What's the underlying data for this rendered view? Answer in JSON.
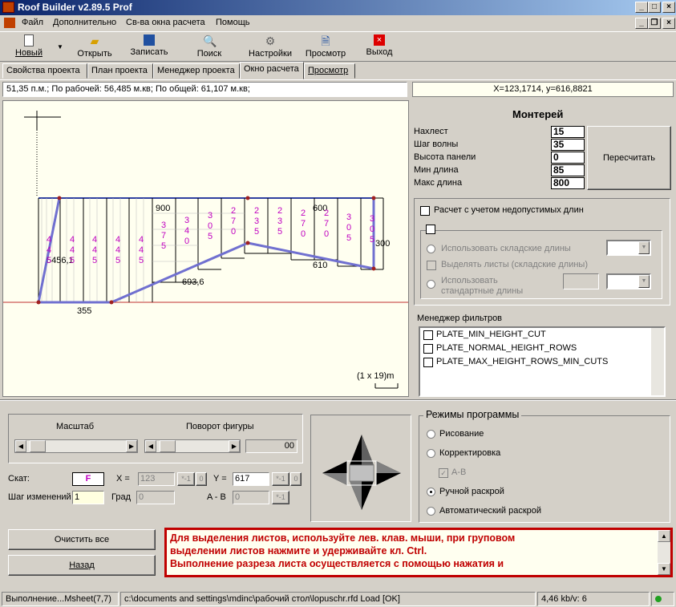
{
  "window": {
    "title": "Roof Builder v2.89.5 Prof"
  },
  "menu": [
    "Файл",
    "Дополнительно",
    "Св-ва окна расчета",
    "Помощь"
  ],
  "toolbar": {
    "new": "Новый",
    "open": "Открыть",
    "save": "Записать",
    "search": "Поиск",
    "settings": "Настройки",
    "preview": "Просмотр",
    "exit": "Выход"
  },
  "tabs": [
    "Свойства проекта",
    "План проекта",
    "Менеджер проекта",
    "Окно расчета",
    "Просмотр"
  ],
  "info": {
    "area": "51,35 п.м.; По рабочей: 56,485 м.кв; По общей:  61,107 м.кв;",
    "coords": "X=123,1714, y=616,8821"
  },
  "drawing": {
    "labels": [
      "900",
      "600",
      "610",
      "300",
      "693,6",
      "355",
      "5456,1"
    ],
    "sheet_lengths": [
      "4 4 5",
      "4 4 5",
      "4 4 5",
      "4 4 5",
      "4 4 5",
      "3 7 5",
      "3 4 0",
      "3 0 5",
      "2 7 0",
      "2 3 5",
      "2 3 5",
      "2 7 0",
      "2 7 0",
      "3 0 5",
      "3 0 5"
    ],
    "scale_label": "(1 x 19)m"
  },
  "profile": {
    "name": "Монтерей",
    "overlap_label": "Нахлест",
    "overlap": "15",
    "wave_label": "Шаг волны",
    "wave": "35",
    "height_label": "Высота панели",
    "height": "0",
    "minlen_label": "Мин длина",
    "minlen": "85",
    "maxlen_label": "Макс длина",
    "maxlen": "800",
    "recalc": "Пересчитать"
  },
  "options": {
    "invalid_lengths": "Расчет с учетом недопустимых длин",
    "use_stock": "Использовать складские длины",
    "highlight": "Выделять листы (складские длины)",
    "use_std_1": "Использовать",
    "use_std_2": "стандартные длины"
  },
  "filters": {
    "title": "Менеджер фильтров",
    "items": [
      "PLATE_MIN_HEIGHT_CUT",
      "PLATE_NORMAL_HEIGHT_ROWS",
      "PLATE_MAX_HEIGHT_ROWS_MIN_CUTS"
    ]
  },
  "controls": {
    "scale_label": "Масштаб",
    "rotate_label": "Поворот фигуры",
    "rotate_value": "00",
    "slope_label": "Скат:",
    "slope": "F",
    "x_label": "X =",
    "x": "123",
    "x_btn1": "*-1",
    "x_btn2": "0",
    "y_label": "Y =",
    "y": "617",
    "y_btn1": "*-1",
    "y_btn2": "0",
    "step_label": "Шаг изменений",
    "step": "1",
    "deg_label": "Град",
    "deg": "0",
    "ab_label": "A - B",
    "ab": "0",
    "ab_btn": "*-1"
  },
  "modes": {
    "title": "Режимы программы",
    "draw": "Рисование",
    "correct": "Корректировка",
    "ab": "A-B",
    "manual": "Ручной раскрой",
    "auto": "Автоматический раскрой"
  },
  "buttons": {
    "clear": "Очистить все",
    "back": "Назад"
  },
  "message": [
    "Для выделения листов, используйте лев. клав. мыши, при груповом",
    "выделении листов нажмите и удерживайте кл. Ctrl.",
    "Выполнение разреза листа осуществляется с помощью нажатия и"
  ],
  "status": {
    "left": "Выполнение...Msheet(7,7)",
    "path": "c:\\documents and settings\\mdinc\\рабочий стол\\lopuschr.rfd Load [OK]",
    "speed": "4,46 kb/v: 6"
  },
  "colors": {
    "accent_red": "#c00000",
    "sheet_text": "#c000c0",
    "line_blue": "#7070d0"
  }
}
